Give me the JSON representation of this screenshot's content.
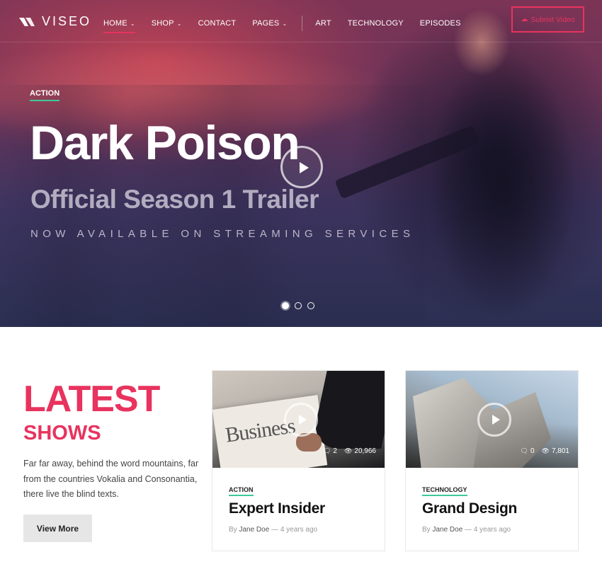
{
  "nav": {
    "logo_text": "VISEO",
    "items": [
      {
        "label": "HOME",
        "has_dropdown": true,
        "active": true
      },
      {
        "label": "SHOP",
        "has_dropdown": true
      },
      {
        "label": "CONTACT",
        "has_dropdown": false
      },
      {
        "label": "PAGES",
        "has_dropdown": true
      },
      {
        "label": "ART",
        "has_dropdown": false
      },
      {
        "label": "TECHNOLOGY",
        "has_dropdown": false
      },
      {
        "label": "EPISODES",
        "has_dropdown": false
      }
    ],
    "submit_label": "Submit Video",
    "submit_icon": "cloud-upload-icon"
  },
  "hero": {
    "category": "ACTION",
    "title": "Dark Poison",
    "subtitle": "Official Season 1 Trailer",
    "tagline": "NOW AVAILABLE ON STREAMING SERVICES",
    "slides": 3,
    "active_slide": 1
  },
  "latest": {
    "title": "LATEST",
    "subtitle": "SHOWS",
    "description": "Far far away, behind the word mountains, far from the countries Vokalia and Consonantia, there live the blind texts.",
    "button_label": "View More"
  },
  "cards": [
    {
      "category": "ACTION",
      "title": "Expert Insider",
      "author": "Jane Doe",
      "time": "4 years ago",
      "comments": "2",
      "views": "20,966",
      "thumb_text": "Business"
    },
    {
      "category": "TECHNOLOGY",
      "title": "Grand Design",
      "author": "Jane Doe",
      "time": "4 years ago",
      "comments": "0",
      "views": "7,801"
    }
  ],
  "colors": {
    "accent": "#e8335e",
    "category_underline": "#3ec99a"
  }
}
